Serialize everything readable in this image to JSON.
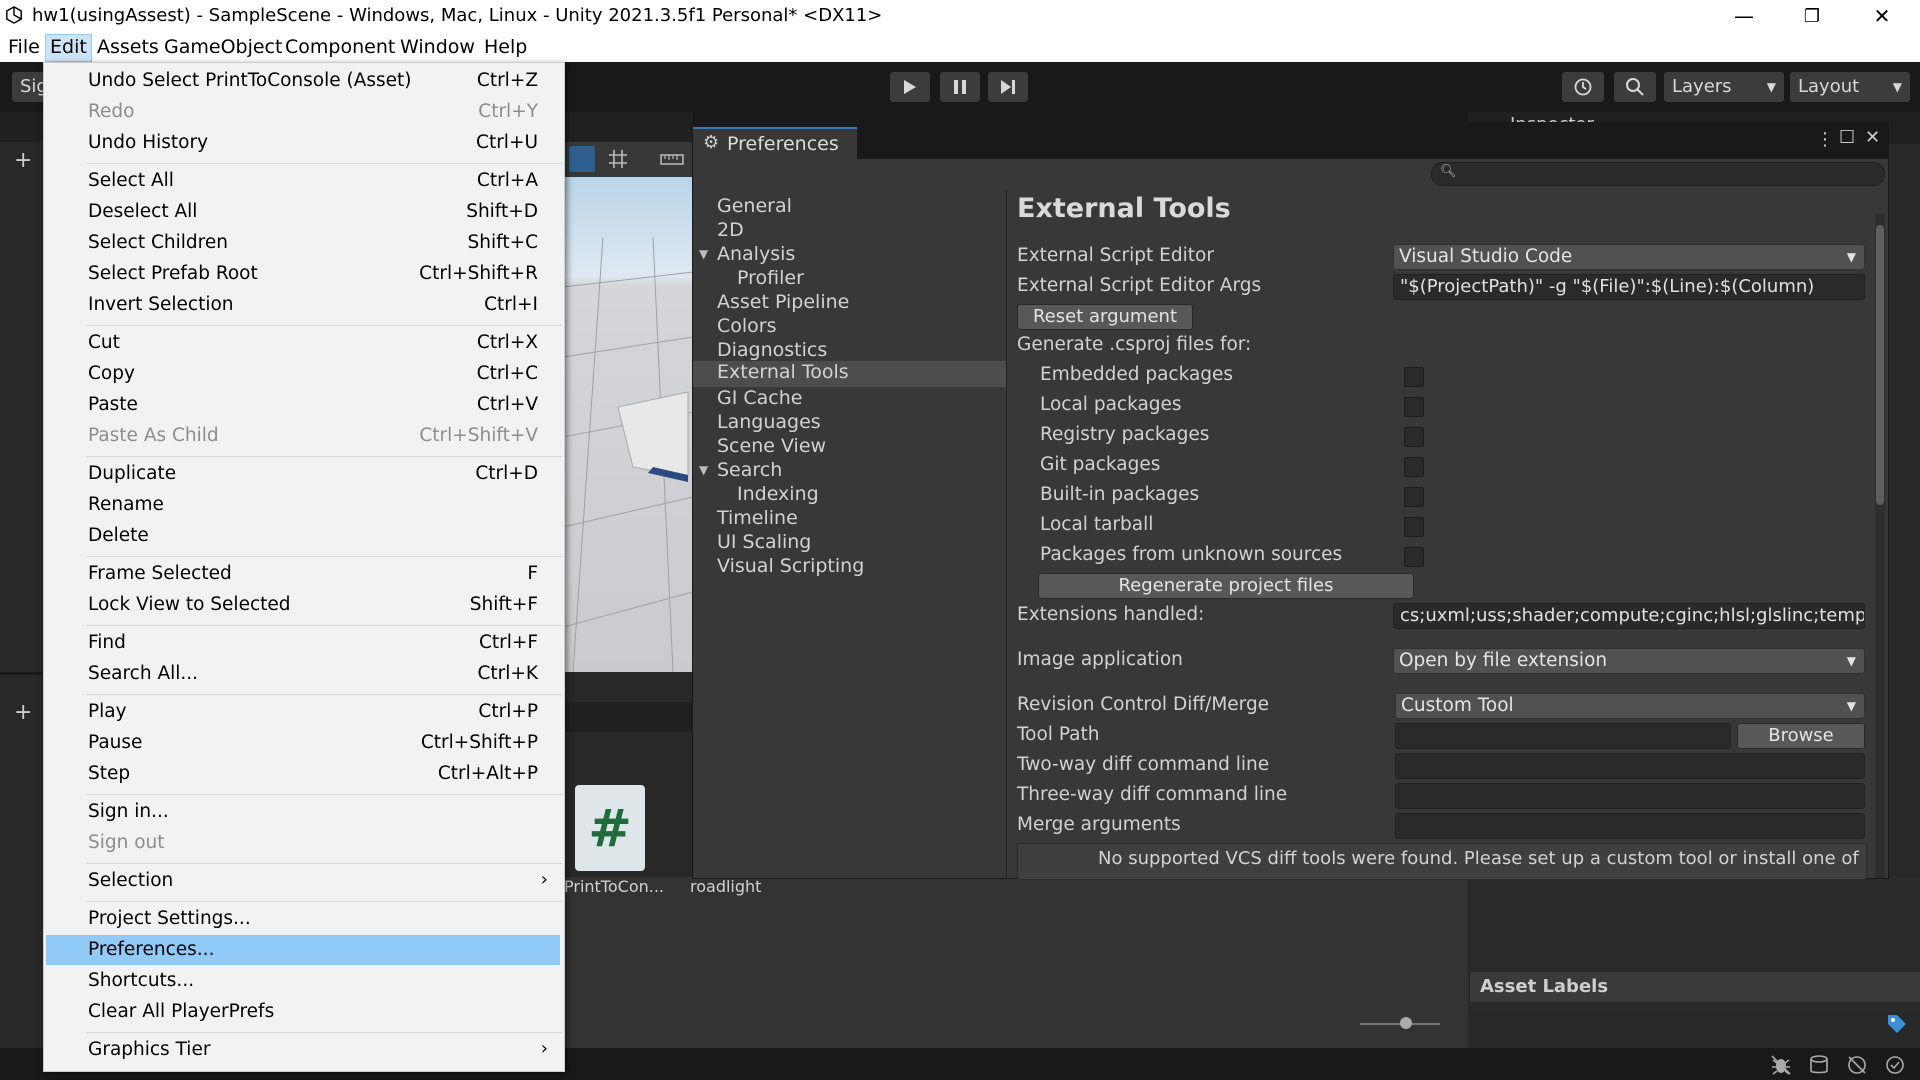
{
  "window": {
    "title": "hw1(usingAssest) - SampleScene - Windows, Mac, Linux - Unity 2021.3.5f1 Personal* <DX11>",
    "minimize": "—",
    "restore": "❐",
    "close": "✕"
  },
  "menubar": [
    "File",
    "Edit",
    "Assets",
    "GameObject",
    "Component",
    "Window",
    "Help"
  ],
  "toolbar": {
    "layers_label": "Layers",
    "layout_label": "Layout",
    "account_partial": "Sig"
  },
  "edit_menu": {
    "items": [
      {
        "label": "Undo Select PrintToConsole (Asset)",
        "shortcut": "Ctrl+Z"
      },
      {
        "label": "Redo",
        "shortcut": "Ctrl+Y"
      },
      {
        "label": "Undo History",
        "shortcut": "Ctrl+U"
      },
      {
        "label": "Select All",
        "shortcut": "Ctrl+A"
      },
      {
        "label": "Deselect All",
        "shortcut": "Shift+D"
      },
      {
        "label": "Select Children",
        "shortcut": "Shift+C"
      },
      {
        "label": "Select Prefab Root",
        "shortcut": "Ctrl+Shift+R"
      },
      {
        "label": "Invert Selection",
        "shortcut": "Ctrl+I"
      },
      {
        "label": "Cut",
        "shortcut": "Ctrl+X"
      },
      {
        "label": "Copy",
        "shortcut": "Ctrl+C"
      },
      {
        "label": "Paste",
        "shortcut": "Ctrl+V"
      },
      {
        "label": "Paste As Child",
        "shortcut": "Ctrl+Shift+V"
      },
      {
        "label": "Duplicate",
        "shortcut": "Ctrl+D"
      },
      {
        "label": "Rename",
        "shortcut": ""
      },
      {
        "label": "Delete",
        "shortcut": ""
      },
      {
        "label": "Frame Selected",
        "shortcut": "F"
      },
      {
        "label": "Lock View to Selected",
        "shortcut": "Shift+F"
      },
      {
        "label": "Find",
        "shortcut": "Ctrl+F"
      },
      {
        "label": "Search All...",
        "shortcut": "Ctrl+K"
      },
      {
        "label": "Play",
        "shortcut": "Ctrl+P"
      },
      {
        "label": "Pause",
        "shortcut": "Ctrl+Shift+P"
      },
      {
        "label": "Step",
        "shortcut": "Ctrl+Alt+P"
      },
      {
        "label": "Sign in...",
        "shortcut": ""
      },
      {
        "label": "Sign out",
        "shortcut": ""
      },
      {
        "label": "Selection",
        "shortcut": ""
      },
      {
        "label": "Project Settings...",
        "shortcut": ""
      },
      {
        "label": "Preferences...",
        "shortcut": ""
      },
      {
        "label": "Shortcuts...",
        "shortcut": ""
      },
      {
        "label": "Clear All PlayerPrefs",
        "shortcut": ""
      },
      {
        "label": "Graphics Tier",
        "shortcut": ""
      }
    ],
    "submenu_arrow": "›"
  },
  "preferences": {
    "tab_title": "Preferences",
    "categories": [
      {
        "label": "General"
      },
      {
        "label": "2D"
      },
      {
        "label": "Analysis"
      },
      {
        "label": "Profiler"
      },
      {
        "label": "Asset Pipeline"
      },
      {
        "label": "Colors"
      },
      {
        "label": "Diagnostics"
      },
      {
        "label": "External Tools"
      },
      {
        "label": "GI Cache"
      },
      {
        "label": "Languages"
      },
      {
        "label": "Scene View"
      },
      {
        "label": "Search"
      },
      {
        "label": "Indexing"
      },
      {
        "label": "Timeline"
      },
      {
        "label": "UI Scaling"
      },
      {
        "label": "Visual Scripting"
      }
    ],
    "heading": "External Tools",
    "external_script_editor_label": "External Script Editor",
    "external_script_editor_value": "Visual Studio Code",
    "editor_args_label": "External Script Editor Args",
    "editor_args_value": "\"$(ProjectPath)\" -g \"$(File)\":$(Line):$(Column)",
    "reset_argument": "Reset argument",
    "generate_label": "Generate .csproj files for:",
    "packages": [
      {
        "label": "Embedded packages",
        "checked": false
      },
      {
        "label": "Local packages",
        "checked": false
      },
      {
        "label": "Registry packages",
        "checked": false
      },
      {
        "label": "Git packages",
        "checked": false
      },
      {
        "label": "Built-in packages",
        "checked": false
      },
      {
        "label": "Local tarball",
        "checked": false
      },
      {
        "label": "Packages from unknown sources",
        "checked": false
      }
    ],
    "regenerate": "Regenerate project files",
    "extensions_label": "Extensions handled:",
    "extensions_value": "cs;uxml;uss;shader;compute;cginc;hlsl;glslinc;templ",
    "image_app_label": "Image application",
    "image_app_value": "Open by file extension",
    "revision_label": "Revision Control Diff/Merge",
    "revision_value": "Custom Tool",
    "tool_path_label": "Tool Path",
    "tool_path_value": "",
    "browse": "Browse",
    "two_way_label": "Two-way diff command line",
    "three_way_label": "Three-way diff command line",
    "merge_label": "Merge arguments",
    "vcs_message": "No supported VCS diff tools were found. Please set up a custom tool or install one of"
  },
  "project": {
    "asset1": "PrintToCon...",
    "asset2": "roadlight",
    "asset_labels": "Asset Labels",
    "inspector_partial": "Inspector"
  }
}
